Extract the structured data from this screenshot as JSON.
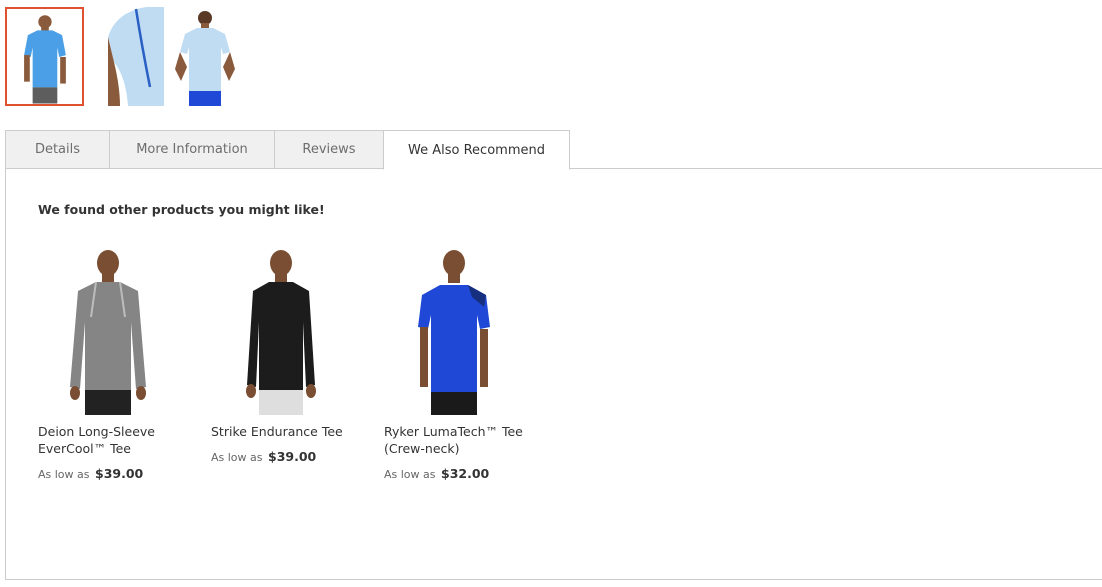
{
  "gallery": {
    "thumbnails": [
      {
        "alt": "Front view - light blue tee",
        "selected": true
      },
      {
        "alt": "Sleeve detail"
      },
      {
        "alt": "Back view"
      }
    ],
    "accent_color": "#e0512f"
  },
  "tabs": [
    {
      "label": "Details"
    },
    {
      "label": "More Information"
    },
    {
      "label": "Reviews"
    },
    {
      "label": "We Also Recommend",
      "active": true
    }
  ],
  "recommend": {
    "heading": "We found other products you might like!",
    "products": [
      {
        "name": "Deion Long-Sleeve EverCool™ Tee",
        "price_prefix": "As low as",
        "price": "$39.00",
        "shirt_color": "#858585",
        "shorts_color": "#222222"
      },
      {
        "name": "Strike Endurance Tee",
        "price_prefix": "As low as",
        "price": "$39.00",
        "shirt_color": "#1c1c1c",
        "shorts_color": "#dedede"
      },
      {
        "name": "Ryker LumaTech™ Tee (Crew-neck)",
        "price_prefix": "As low as",
        "price": "$32.00",
        "shirt_color": "#1f48d6",
        "shorts_color": "#1a1a1a"
      }
    ]
  }
}
